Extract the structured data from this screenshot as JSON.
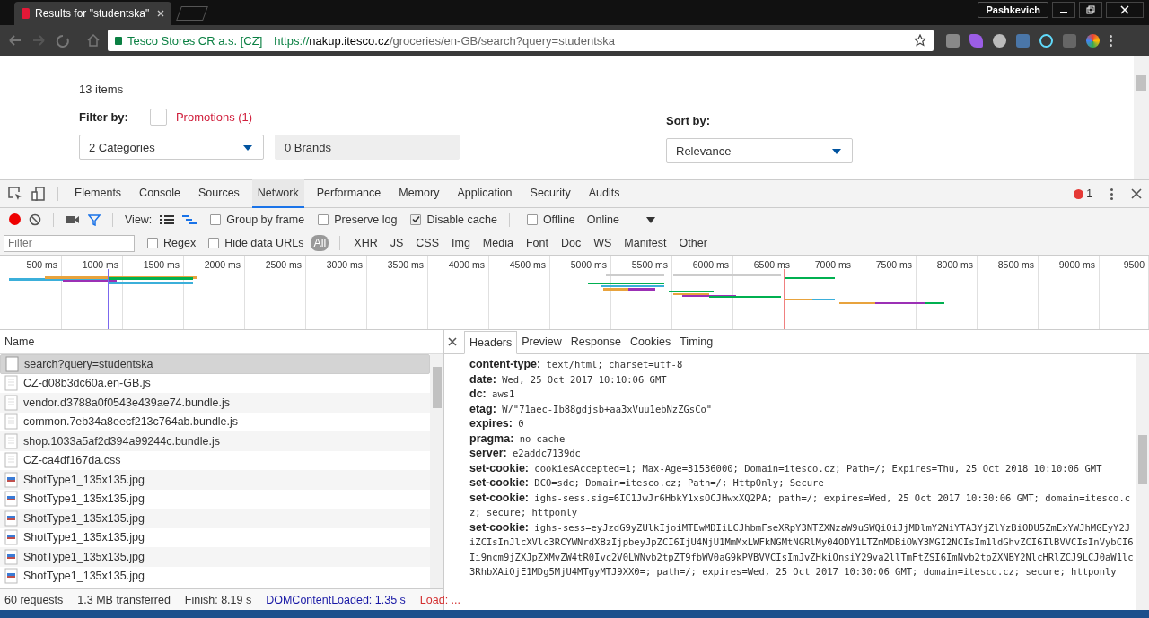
{
  "browser": {
    "tab_title": "Results for \"studentska\"",
    "user": "Pashkevich",
    "secure_label": "Tesco Stores CR a.s. [CZ]",
    "url_scheme": "https://",
    "url_host": "nakup.itesco.cz",
    "url_path": "/groceries/en-GB/search?query=studentska"
  },
  "page": {
    "count": "13 items",
    "filter_label": "Filter by:",
    "promotions": {
      "label": "Promotions (1)",
      "checked": false
    },
    "categories": "2 Categories",
    "brands": "0 Brands",
    "sort_label": "Sort by:",
    "sort_value": "Relevance"
  },
  "devtools": {
    "tabs": [
      {
        "label": "Elements",
        "selected": false
      },
      {
        "label": "Console",
        "selected": false
      },
      {
        "label": "Sources",
        "selected": false
      },
      {
        "label": "Network",
        "selected": true
      },
      {
        "label": "Performance",
        "selected": false
      },
      {
        "label": "Memory",
        "selected": false
      },
      {
        "label": "Application",
        "selected": false
      },
      {
        "label": "Security",
        "selected": false
      },
      {
        "label": "Audits",
        "selected": false
      }
    ],
    "error_count": "1",
    "recording": true,
    "view_label": "View:",
    "options": [
      {
        "label": "Group by frame",
        "checked": false
      },
      {
        "label": "Preserve log",
        "checked": false
      },
      {
        "label": "Disable cache",
        "checked": true
      },
      {
        "label": "Offline",
        "checked": false
      }
    ],
    "throttling": "Online",
    "filter_placeholder": "Filter",
    "filter_options": [
      {
        "label": "Regex",
        "checked": false
      },
      {
        "label": "Hide data URLs",
        "checked": false
      }
    ],
    "types": [
      {
        "label": "All",
        "selected": true
      },
      {
        "label": "XHR",
        "selected": false
      },
      {
        "label": "JS",
        "selected": false
      },
      {
        "label": "CSS",
        "selected": false
      },
      {
        "label": "Img",
        "selected": false
      },
      {
        "label": "Media",
        "selected": false
      },
      {
        "label": "Font",
        "selected": false
      },
      {
        "label": "Doc",
        "selected": false
      },
      {
        "label": "WS",
        "selected": false
      },
      {
        "label": "Manifest",
        "selected": false
      },
      {
        "label": "Other",
        "selected": false
      }
    ],
    "timeline_ticks": [
      "500 ms",
      "1000 ms",
      "1500 ms",
      "2000 ms",
      "2500 ms",
      "3000 ms",
      "3500 ms",
      "4000 ms",
      "4500 ms",
      "5000 ms",
      "5500 ms",
      "6000 ms",
      "6500 ms",
      "7000 ms",
      "7500 ms",
      "8000 ms",
      "8500 ms",
      "9000 ms",
      "9500"
    ],
    "name_column": "Name",
    "requests": [
      {
        "name": "search?query=studentska",
        "kind": "document",
        "selected": true
      },
      {
        "name": "CZ-d08b3dc60a.en-GB.js",
        "kind": "script",
        "selected": false
      },
      {
        "name": "vendor.d3788a0f0543e439ae74.bundle.js",
        "kind": "script",
        "selected": false
      },
      {
        "name": "common.7eb34a8eecf213c764ab.bundle.js",
        "kind": "script",
        "selected": false
      },
      {
        "name": "shop.1033a5af2d394a99244c.bundle.js",
        "kind": "script",
        "selected": false
      },
      {
        "name": "CZ-ca4df167da.css",
        "kind": "script",
        "selected": false
      },
      {
        "name": "ShotType1_135x135.jpg",
        "kind": "image",
        "selected": false
      },
      {
        "name": "ShotType1_135x135.jpg",
        "kind": "image",
        "selected": false
      },
      {
        "name": "ShotType1_135x135.jpg",
        "kind": "image",
        "selected": false
      },
      {
        "name": "ShotType1_135x135.jpg",
        "kind": "image",
        "selected": false
      },
      {
        "name": "ShotType1_135x135.jpg",
        "kind": "image",
        "selected": false
      },
      {
        "name": "ShotType1_135x135.jpg",
        "kind": "image",
        "selected": false
      }
    ],
    "status": {
      "requests": "60 requests",
      "transferred": "1.3 MB transferred",
      "finish": "Finish: 8.19 s",
      "dom": "DOMContentLoaded: 1.35 s",
      "load": "Load: ..."
    },
    "detail_tabs": [
      {
        "label": "Headers",
        "selected": true
      },
      {
        "label": "Preview",
        "selected": false
      },
      {
        "label": "Response",
        "selected": false
      },
      {
        "label": "Cookies",
        "selected": false
      },
      {
        "label": "Timing",
        "selected": false
      }
    ],
    "headers": [
      {
        "name": "content-type:",
        "value": "text/html; charset=utf-8"
      },
      {
        "name": "date:",
        "value": "Wed, 25 Oct 2017 10:10:06 GMT"
      },
      {
        "name": "dc:",
        "value": "aws1"
      },
      {
        "name": "etag:",
        "value": "W/\"71aec-Ib88gdjsb+aa3xVuu1ebNzZGsCo\""
      },
      {
        "name": "expires:",
        "value": "0"
      },
      {
        "name": "pragma:",
        "value": "no-cache"
      },
      {
        "name": "server:",
        "value": "e2addc7139dc"
      },
      {
        "name": "set-cookie:",
        "value": "cookiesAccepted=1; Max-Age=31536000; Domain=itesco.cz; Path=/; Expires=Thu, 25 Oct 2018 10:10:06 GMT"
      },
      {
        "name": "set-cookie:",
        "value": "DCO=sdc; Domain=itesco.cz; Path=/; HttpOnly; Secure"
      },
      {
        "name": "set-cookie:",
        "value": "ighs-sess.sig=6IC1JwJr6HbkY1xsOCJHwxXQ2PA; path=/; expires=Wed, 25 Oct 2017 10:30:06 GMT; domain=itesco.cz; secure; httponly"
      },
      {
        "name": "set-cookie:",
        "value": "ighs-sess=eyJzdG9yZUlkIjoiMTEwMDIiLCJhbmFseXRpY3NTZXNzaW9uSWQiOiJjMDlmY2NiYTA3YjZlYzBiODU5ZmExYWJhMGEyY2JiZCIsInJlcXVlc3RCYWNrdXBzIjpbeyJpZCI6IjU4NjU1MmMxLWFkNGMtNGRlMy04ODY1LTZmMDBiOWY3MGI2NCIsIm1ldGhvZCI6IlBVVCIsInVybCI6Ii9ncm9jZXJpZXMvZW4tR0Ivc2V0LWNvb2tpZT9fbWV0aG9kPVBVVCIsImJvZHkiOnsiY29va2llTmFtZSI6ImNvb2tpZXNBY2NlcHRlZCJ9LCJ0aW1lc3RhbXAiOjE1MDg5MjU4MTgyMTJ9XX0=; path=/; expires=Wed, 25 Oct 2017 10:30:06 GMT; domain=itesco.cz; secure; httponly"
      }
    ]
  }
}
